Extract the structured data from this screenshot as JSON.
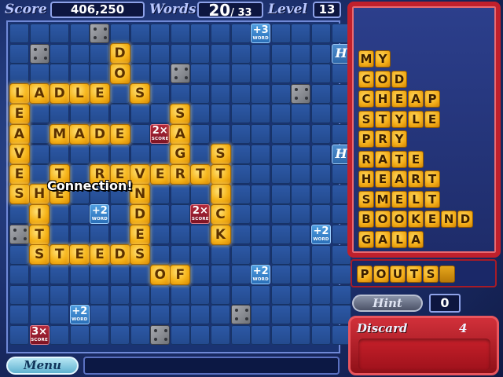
{
  "header": {
    "score_label": "Score",
    "score_value": "406,250",
    "words_label": "Words",
    "words_found": "20",
    "words_total": "/ 33",
    "level_label": "Level",
    "level_value": "13"
  },
  "board": {
    "message": "Connection!",
    "tiles": [
      {
        "letter": "D",
        "col": 5,
        "row": 1
      },
      {
        "letter": "O",
        "col": 5,
        "row": 2
      },
      {
        "letter": "L",
        "col": 0,
        "row": 3
      },
      {
        "letter": "A",
        "col": 1,
        "row": 3
      },
      {
        "letter": "D",
        "col": 2,
        "row": 3
      },
      {
        "letter": "L",
        "col": 3,
        "row": 3
      },
      {
        "letter": "E",
        "col": 4,
        "row": 3
      },
      {
        "letter": "S",
        "col": 6,
        "row": 3
      },
      {
        "letter": "E",
        "col": 0,
        "row": 4
      },
      {
        "letter": "S",
        "col": 8,
        "row": 4
      },
      {
        "letter": "A",
        "col": 0,
        "row": 5
      },
      {
        "letter": "M",
        "col": 2,
        "row": 5
      },
      {
        "letter": "A",
        "col": 3,
        "row": 5
      },
      {
        "letter": "D",
        "col": 4,
        "row": 5
      },
      {
        "letter": "E",
        "col": 5,
        "row": 5
      },
      {
        "letter": "A",
        "col": 8,
        "row": 5
      },
      {
        "letter": "V",
        "col": 0,
        "row": 6
      },
      {
        "letter": "G",
        "col": 8,
        "row": 6
      },
      {
        "letter": "S",
        "col": 10,
        "row": 6
      },
      {
        "letter": "E",
        "col": 0,
        "row": 7
      },
      {
        "letter": "T",
        "col": 2,
        "row": 7
      },
      {
        "letter": "R",
        "col": 4,
        "row": 7
      },
      {
        "letter": "E",
        "col": 5,
        "row": 7
      },
      {
        "letter": "V",
        "col": 6,
        "row": 7
      },
      {
        "letter": "E",
        "col": 7,
        "row": 7
      },
      {
        "letter": "R",
        "col": 8,
        "row": 7
      },
      {
        "letter": "T",
        "col": 9,
        "row": 7
      },
      {
        "letter": "T",
        "col": 10,
        "row": 7
      },
      {
        "letter": "S",
        "col": 0,
        "row": 8
      },
      {
        "letter": "H",
        "col": 1,
        "row": 8
      },
      {
        "letter": "E",
        "col": 2,
        "row": 8
      },
      {
        "letter": "N",
        "col": 6,
        "row": 8
      },
      {
        "letter": "I",
        "col": 10,
        "row": 8
      },
      {
        "letter": "I",
        "col": 1,
        "row": 9
      },
      {
        "letter": "D",
        "col": 6,
        "row": 9
      },
      {
        "letter": "C",
        "col": 10,
        "row": 9
      },
      {
        "letter": "T",
        "col": 1,
        "row": 10
      },
      {
        "letter": "E",
        "col": 6,
        "row": 10
      },
      {
        "letter": "K",
        "col": 10,
        "row": 10
      },
      {
        "letter": "S",
        "col": 1,
        "row": 11
      },
      {
        "letter": "T",
        "col": 2,
        "row": 11
      },
      {
        "letter": "E",
        "col": 3,
        "row": 11
      },
      {
        "letter": "E",
        "col": 4,
        "row": 11
      },
      {
        "letter": "D",
        "col": 5,
        "row": 11
      },
      {
        "letter": "S",
        "col": 6,
        "row": 11
      },
      {
        "letter": "O",
        "col": 7,
        "row": 12
      },
      {
        "letter": "F",
        "col": 8,
        "row": 12
      }
    ],
    "steel": [
      {
        "col": 4,
        "row": 0
      },
      {
        "col": 1,
        "row": 1
      },
      {
        "col": 8,
        "row": 2
      },
      {
        "col": 14,
        "row": 3
      },
      {
        "col": 0,
        "row": 10
      },
      {
        "col": 11,
        "row": 14
      },
      {
        "col": 7,
        "row": 15
      }
    ],
    "bonuses": [
      {
        "col": 12,
        "row": 0,
        "big": "+3",
        "small": "WORD",
        "kind": "word"
      },
      {
        "col": 7,
        "row": 5,
        "big": "2×",
        "small": "SCORE",
        "kind": "score"
      },
      {
        "col": 4,
        "row": 9,
        "big": "+2",
        "small": "WORD",
        "kind": "word"
      },
      {
        "col": 9,
        "row": 9,
        "big": "2×",
        "small": "SCORE",
        "kind": "score"
      },
      {
        "col": 15,
        "row": 10,
        "big": "+2",
        "small": "WORD",
        "kind": "word"
      },
      {
        "col": 12,
        "row": 12,
        "big": "+2",
        "small": "WORD",
        "kind": "word"
      },
      {
        "col": 3,
        "row": 14,
        "big": "+2",
        "small": "WORD",
        "kind": "word"
      },
      {
        "col": 1,
        "row": 15,
        "big": "3×",
        "small": "SCORE",
        "kind": "score"
      }
    ],
    "hmarks": [
      {
        "col": 16,
        "row": 1,
        "glyph": "H"
      },
      {
        "col": 16,
        "row": 6,
        "glyph": "H"
      }
    ]
  },
  "word_list": [
    "MY",
    "COD",
    "CHEAP",
    "STYLE",
    "PRY",
    "RATE",
    "HEART",
    "SMELT",
    "BOOKEND",
    "GALA"
  ],
  "current_word": "POUTS",
  "hint_label": "Hint",
  "hint_count": "0",
  "discard_label": "Discard",
  "discard_count": "4",
  "menu_label": "Menu"
}
